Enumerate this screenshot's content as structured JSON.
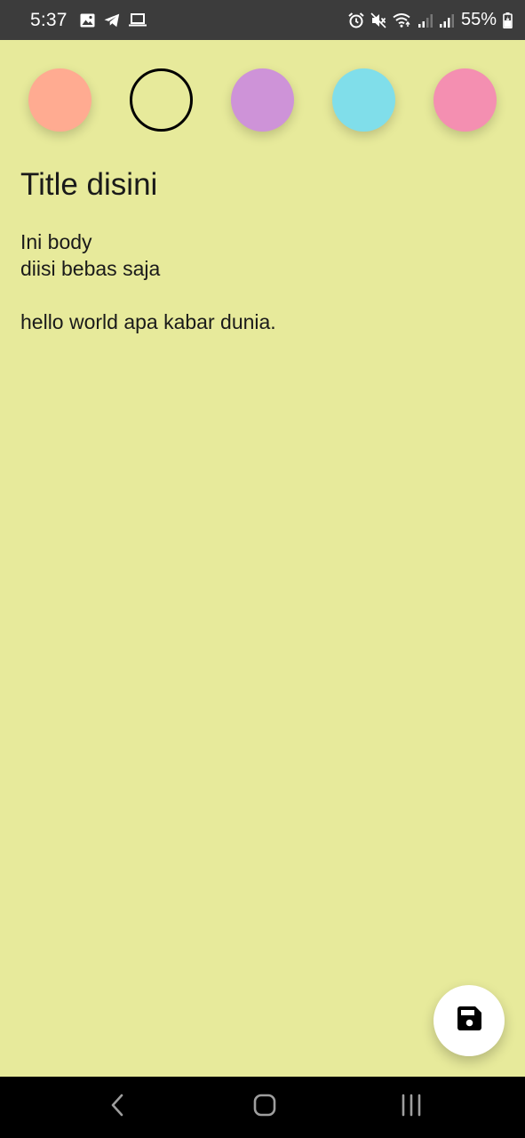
{
  "status_bar": {
    "time": "5:37",
    "left_icons": [
      "image-icon",
      "telegram-icon",
      "laptop-icon"
    ],
    "right_icons": [
      "alarm-icon",
      "mute-icon",
      "wifi-icon",
      "signal-icon",
      "signal-icon"
    ],
    "battery_text": "55%"
  },
  "color_picker": {
    "options": [
      {
        "name": "salmon",
        "color": "#ffab91",
        "selected": false
      },
      {
        "name": "yellow",
        "color": "#e7ea9b",
        "selected": true
      },
      {
        "name": "purple",
        "color": "#ce93d8",
        "selected": false
      },
      {
        "name": "cyan",
        "color": "#80deea",
        "selected": false
      },
      {
        "name": "pink",
        "color": "#f48fb1",
        "selected": false
      }
    ]
  },
  "note": {
    "title": "Title disini",
    "body_lines": [
      "Ini body",
      "diisi bebas saja",
      "",
      "hello world apa kabar dunia."
    ]
  },
  "fab": {
    "icon": "save-icon"
  },
  "nav_bar": {
    "icons": [
      "back-icon",
      "home-icon",
      "recents-icon"
    ]
  },
  "colors": {
    "background": "#e7ea9b",
    "status_bar": "#3c3c3c",
    "nav_bar": "#000000"
  }
}
